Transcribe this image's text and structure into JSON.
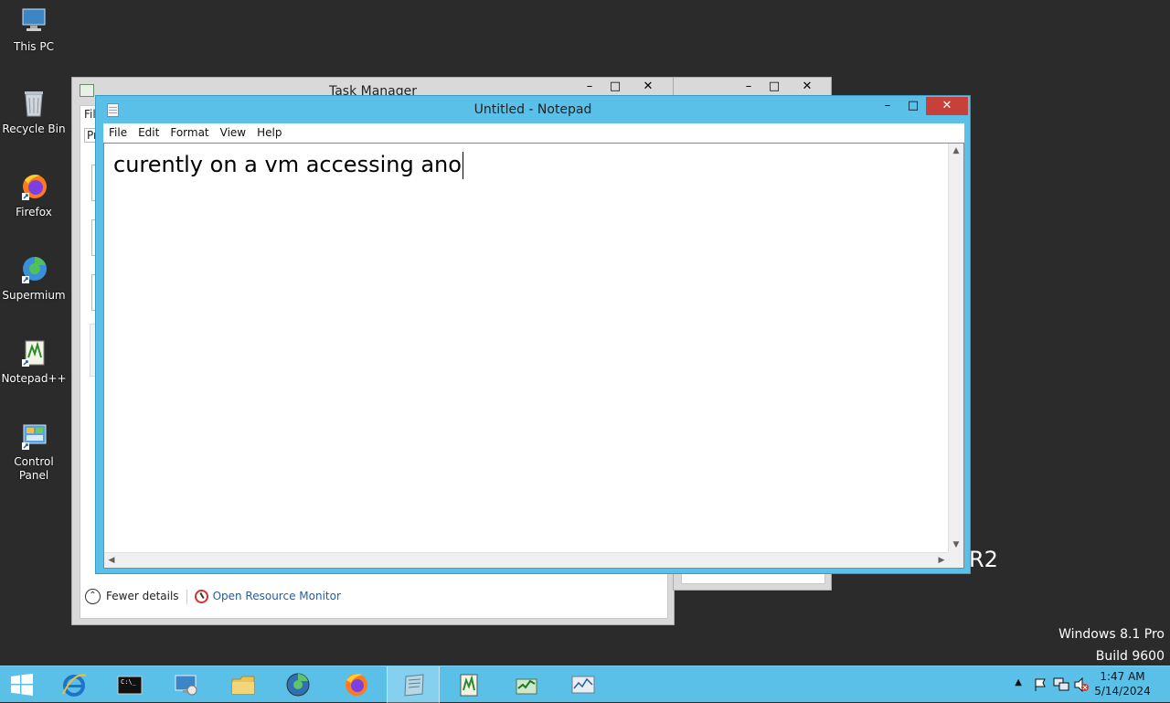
{
  "desktop": {
    "icons": [
      {
        "label": "This PC"
      },
      {
        "label": "Recycle Bin"
      },
      {
        "label": "Firefox"
      },
      {
        "label": "Supermium"
      },
      {
        "label": "Notepad++"
      },
      {
        "label": "Control Panel"
      }
    ],
    "watermark_fragment": "R2",
    "os_name": "Windows 8.1 Pro",
    "os_build": "Build 9600"
  },
  "task_manager": {
    "title": "Task Manager",
    "menu_fragment": "Fil",
    "tab_fragment": "Pr",
    "fewer_details": "Fewer details",
    "open_resource_monitor": "Open Resource Monitor",
    "minimize": "–",
    "maximize": "□",
    "close": "✕"
  },
  "second_window": {
    "minimize": "–",
    "maximize": "□",
    "close": "✕"
  },
  "notepad": {
    "title": "Untitled - Notepad",
    "menu": [
      "File",
      "Edit",
      "Format",
      "View",
      "Help"
    ],
    "content": "curently on a vm accessing ano",
    "minimize": "–",
    "maximize": "□",
    "close": "✕"
  },
  "taskbar": {
    "apps": [
      "start",
      "internet-explorer",
      "command-prompt",
      "remote-desktop",
      "file-explorer",
      "supermium",
      "firefox",
      "notepad",
      "notepad-plus-plus",
      "task-manager",
      "performance-monitor"
    ],
    "active_app": "notepad",
    "tray_icons": [
      "show-hidden-icons",
      "action-center-flag",
      "network",
      "volume-muted"
    ],
    "time": "1:47 AM",
    "date": "5/14/2024"
  },
  "colors": {
    "taskbar": "#5bc0e8",
    "desktop": "#2b2b2b",
    "close_button": "#c7403a"
  }
}
